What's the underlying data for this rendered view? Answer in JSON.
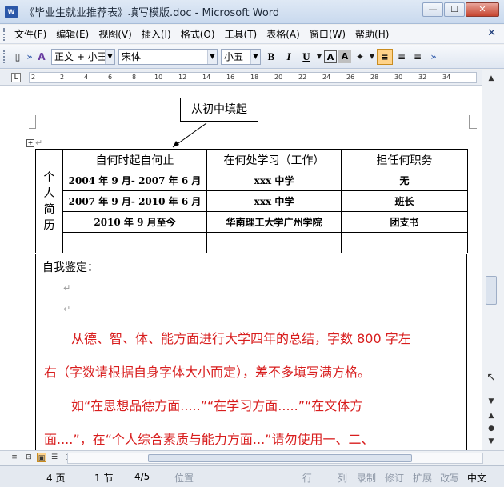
{
  "window": {
    "title": "《毕业生就业推荐表》填写模版.doc - Microsoft Word",
    "icon_label": "W",
    "minimize": "—",
    "maximize": "☐",
    "close": "✕"
  },
  "menu": {
    "items": [
      "文件(F)",
      "编辑(E)",
      "视图(V)",
      "插入(I)",
      "格式(O)",
      "工具(T)",
      "表格(A)",
      "窗口(W)",
      "帮助(H)"
    ],
    "close_doc": "✕"
  },
  "toolbar": {
    "style_value": "正文 + 小王",
    "font_value": "宋体",
    "size_value": "小五",
    "bold": "B",
    "italic": "I",
    "underline": "U",
    "char_border": "A",
    "char_shading": "A",
    "ruler_corner": "L"
  },
  "ruler": {
    "numbers": [
      "2",
      "2",
      "4",
      "6",
      "8",
      "10",
      "12",
      "14",
      "16",
      "18",
      "20",
      "22",
      "24",
      "26",
      "28",
      "30",
      "32",
      "34"
    ]
  },
  "document": {
    "callout": "从初中填起",
    "table": {
      "side_label": [
        "个",
        "人",
        "简",
        "历"
      ],
      "headers": [
        "自何时起自何止",
        "在何处学习（工作）",
        "担任何职务"
      ],
      "rows": [
        [
          "2004 年 9 月- 2007 年 6 月",
          "xxx 中学",
          "无"
        ],
        [
          "2007 年 9 月- 2010 年 6 月",
          "xxx 中学",
          "班长"
        ],
        [
          "2010 年 9 月至今",
          "华南理工大学广州学院",
          "团支书"
        ],
        [
          "",
          "",
          ""
        ]
      ]
    },
    "self_label": "自我鉴定：",
    "red_line_1": "从德、智、体、能方面进行大学四年的总结，字数 800 字左",
    "red_line_2": "右（字数请根据自身字体大小而定），差不多填写满方格。",
    "red_line_3": "如“在思想品德方面.....”“在学习方面.....”“在文体方",
    "red_line_4": "面....”，在“个人综合素质与能力方面...”请勿使用一、二、",
    "para_mark": "↵"
  },
  "status": {
    "page": "4 页",
    "section": "1 节",
    "pages": "4/5",
    "position": "位置",
    "line": "行",
    "col": "列",
    "rec": "录制",
    "trk": "修订",
    "ext": "扩展",
    "ovr": "改写",
    "lang": "中文"
  }
}
